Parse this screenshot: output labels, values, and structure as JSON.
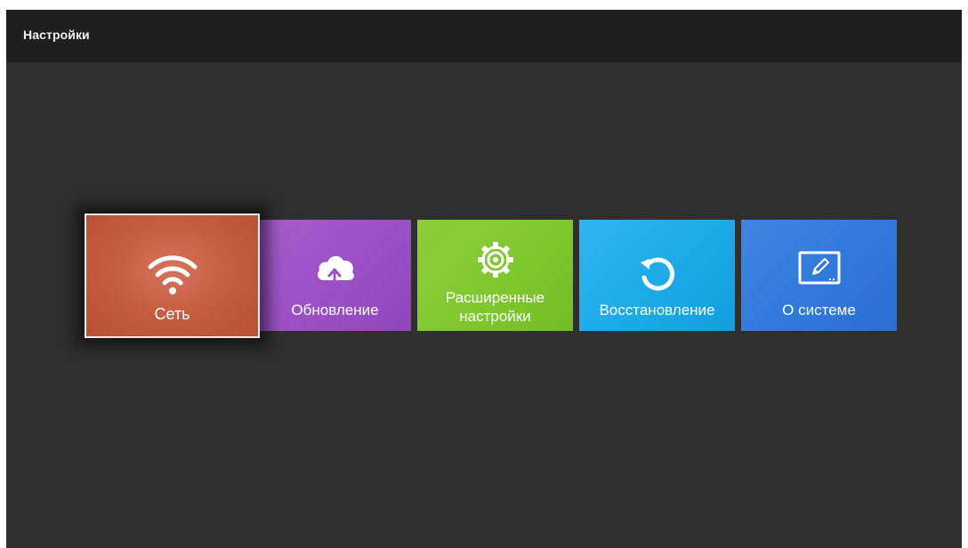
{
  "header": {
    "title": "Настройки"
  },
  "tiles": [
    {
      "id": "network",
      "label": "Сеть",
      "icon": "wifi-icon",
      "color": "#c45a3e",
      "focused": true
    },
    {
      "id": "update",
      "label": "Обновление",
      "icon": "cloud-upload-icon",
      "color": "#9a4fc4",
      "focused": false
    },
    {
      "id": "advanced",
      "label_line1": "Расширенные",
      "label_line2": "настройки",
      "icon": "gear-icon",
      "color": "#7ec72d",
      "focused": false
    },
    {
      "id": "restore",
      "label": "Восстановление",
      "icon": "restore-icon",
      "color": "#1aa8e8",
      "focused": false
    },
    {
      "id": "about",
      "label": "О системе",
      "icon": "system-info-icon",
      "color": "#2f78da",
      "focused": false
    }
  ],
  "colors": {
    "background": "#2f2f2f",
    "topbar": "#1f1f1f",
    "focus_border": "#f3ebe6"
  }
}
